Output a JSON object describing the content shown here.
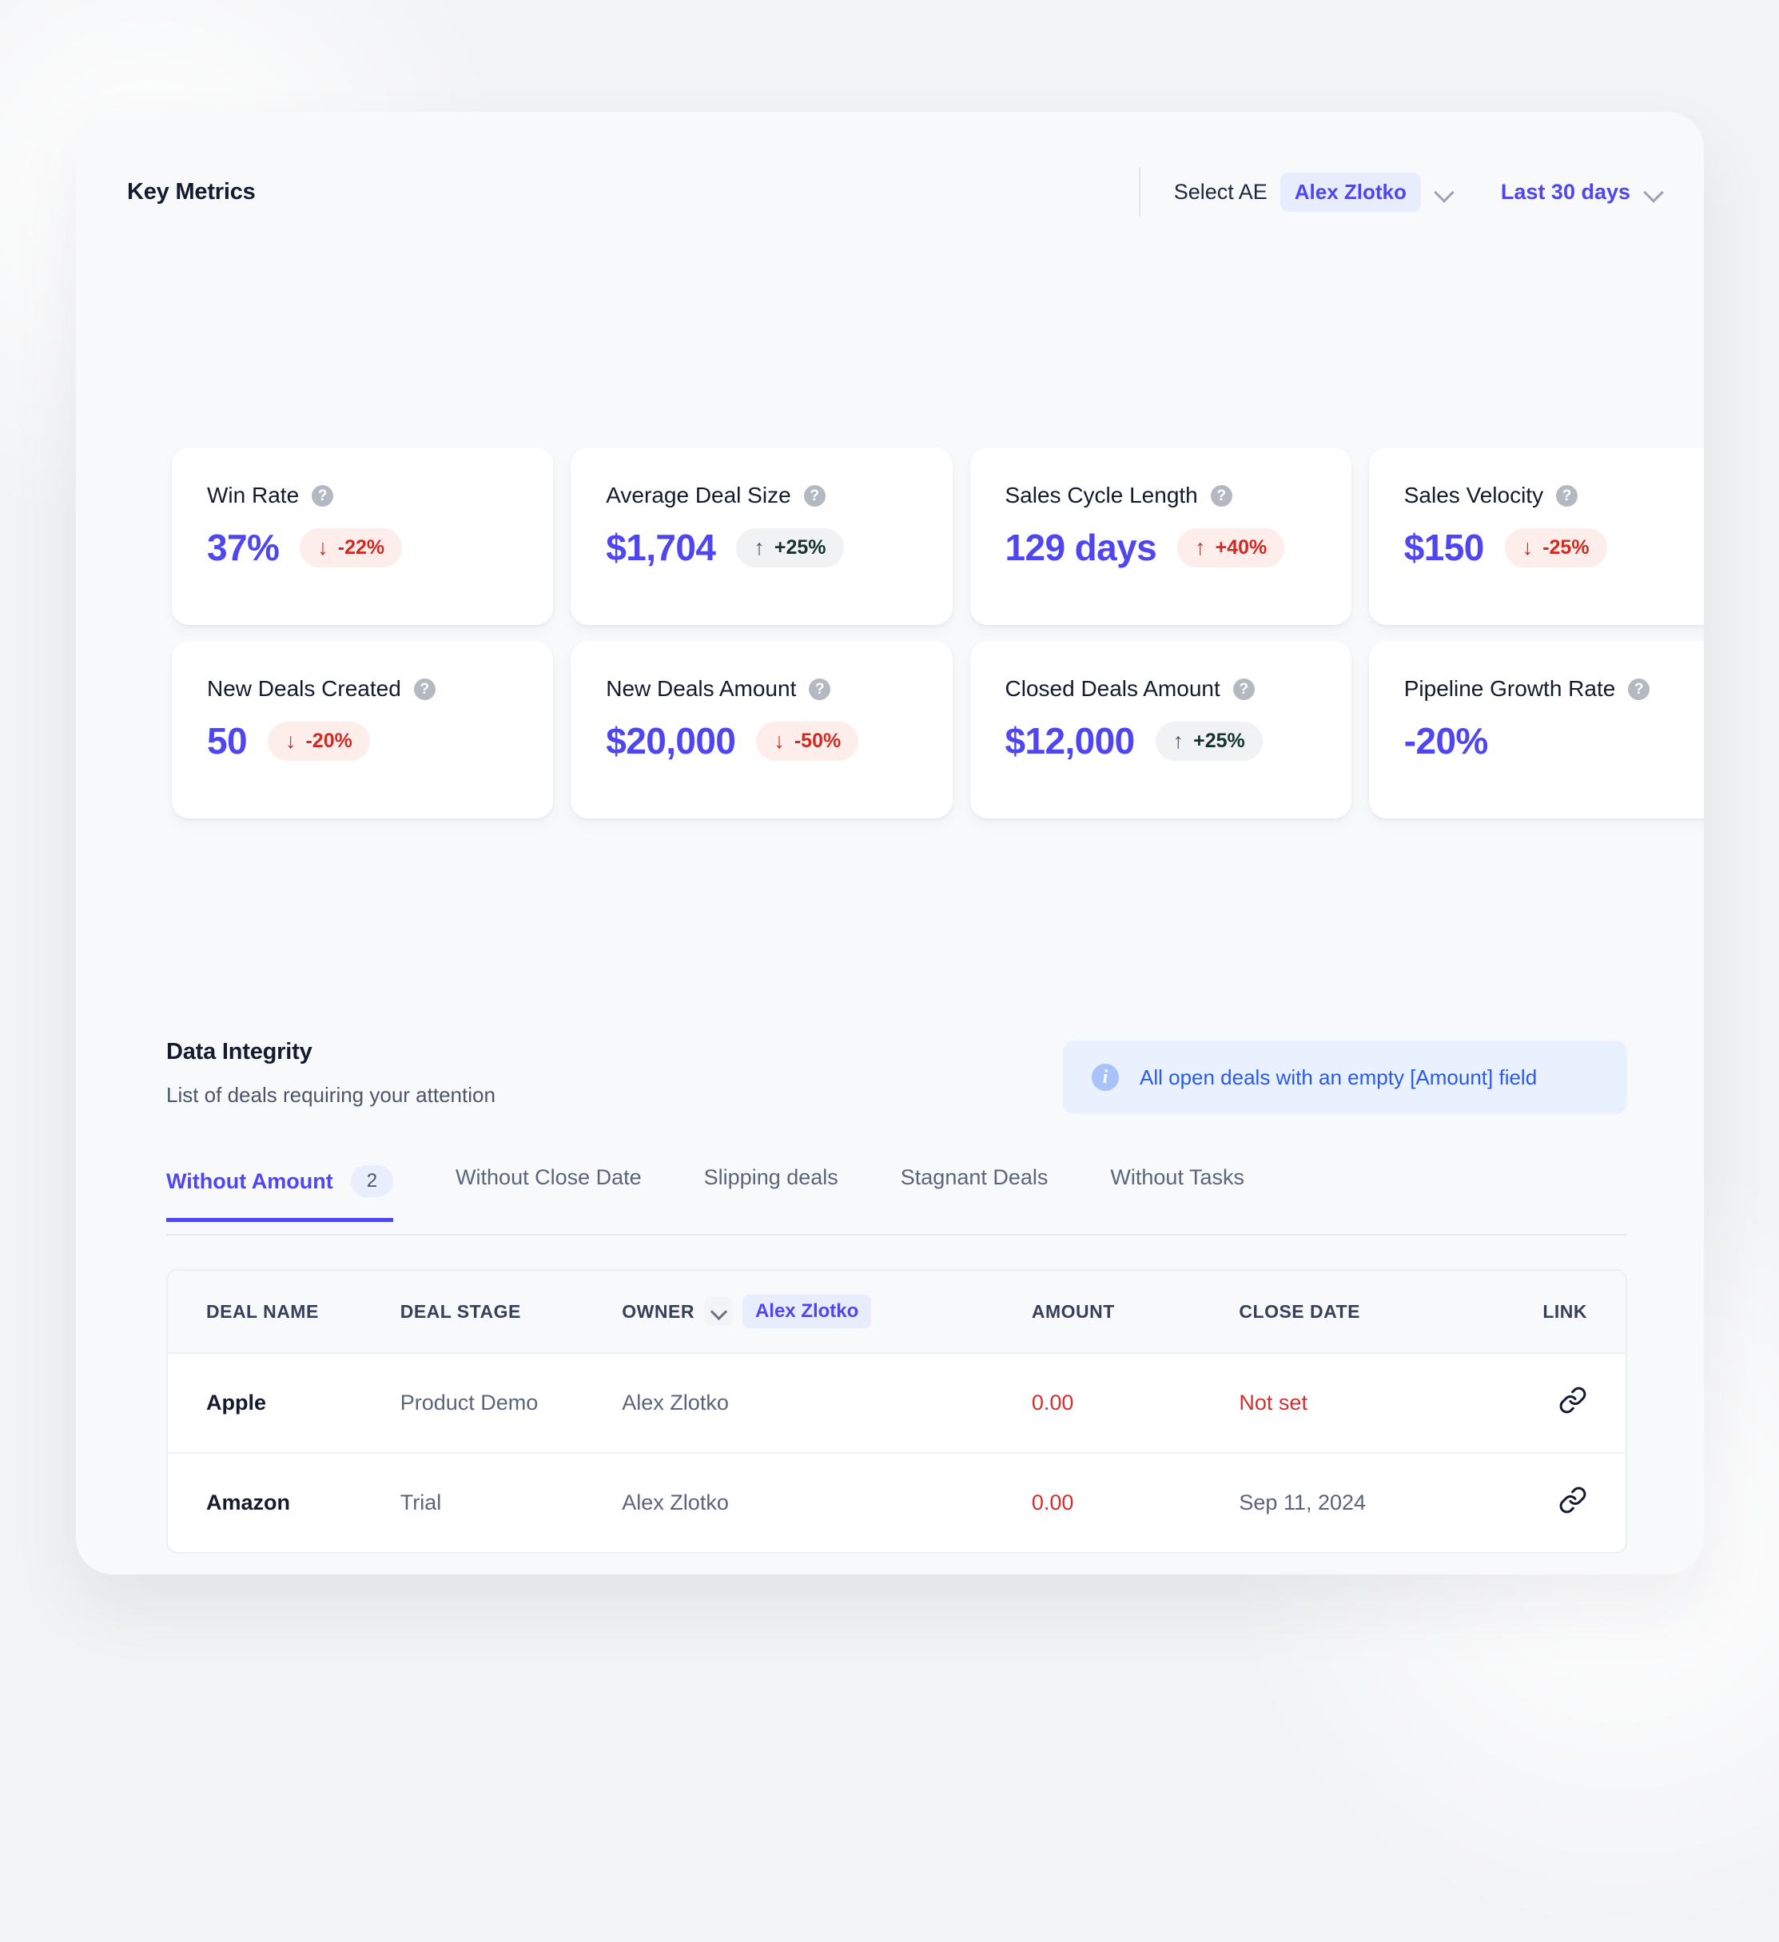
{
  "header": {
    "title": "Key Metrics",
    "select_ae_label": "Select AE",
    "ae_value": "Alex Zlotko",
    "date_range": "Last 30 days"
  },
  "metrics": [
    {
      "label": "Win Rate",
      "value": "37%",
      "delta": "-22%",
      "arrow": "↓",
      "tone": "neg"
    },
    {
      "label": "Average Deal Size",
      "value": "$1,704",
      "delta": "+25%",
      "arrow": "↑",
      "tone": "pos"
    },
    {
      "label": "Sales Cycle Length",
      "value": "129 days",
      "delta": "+40%",
      "arrow": "↑",
      "tone": "neg"
    },
    {
      "label": "Sales Velocity",
      "value": "$150",
      "delta": "-25%",
      "arrow": "↓",
      "tone": "neg"
    },
    {
      "label": "New Deals Created",
      "value": "50",
      "delta": "-20%",
      "arrow": "↓",
      "tone": "neg"
    },
    {
      "label": "New Deals Amount",
      "value": "$20,000",
      "delta": "-50%",
      "arrow": "↓",
      "tone": "neg"
    },
    {
      "label": "Closed Deals Amount",
      "value": "$12,000",
      "delta": "+25%",
      "arrow": "↑",
      "tone": "pos"
    },
    {
      "label": "Pipeline Growth Rate",
      "value": "-20%",
      "delta": "",
      "arrow": "",
      "tone": "none"
    }
  ],
  "help_icon_glyph": "?",
  "data_integrity": {
    "title": "Data Integrity",
    "subtitle": "List of deals requiring your attention",
    "banner_text": "All open deals with an empty [Amount] field",
    "info_icon_glyph": "i"
  },
  "tabs": [
    {
      "label": "Without Amount",
      "count": "2",
      "active": true
    },
    {
      "label": "Without Close Date",
      "count": "",
      "active": false
    },
    {
      "label": "Slipping deals",
      "count": "",
      "active": false
    },
    {
      "label": "Stagnant Deals",
      "count": "",
      "active": false
    },
    {
      "label": "Without Tasks",
      "count": "",
      "active": false
    }
  ],
  "table": {
    "columns": {
      "deal_name": "DEAL NAME",
      "deal_stage": "DEAL STAGE",
      "owner": "OWNER",
      "owner_filter_value": "Alex Zlotko",
      "amount": "AMOUNT",
      "close_date": "CLOSE DATE",
      "link": "LINK"
    },
    "rows": [
      {
        "deal_name": "Apple",
        "deal_stage": "Product Demo",
        "owner": "Alex Zlotko",
        "amount": "0.00",
        "close_date": "Not set",
        "close_date_missing": true
      },
      {
        "deal_name": "Amazon",
        "deal_stage": "Trial",
        "owner": "Alex Zlotko",
        "amount": "0.00",
        "close_date": "Sep 11, 2024",
        "close_date_missing": false
      }
    ]
  },
  "colors": {
    "accent": "#4f46f0",
    "negative": "#cf2a23",
    "positive_text": "#16342b",
    "banner_bg": "#e9f0fe",
    "banner_text": "#2a5ae8",
    "panel_bg": "#f8f9fb",
    "page_bg": "#f2f3f5"
  }
}
